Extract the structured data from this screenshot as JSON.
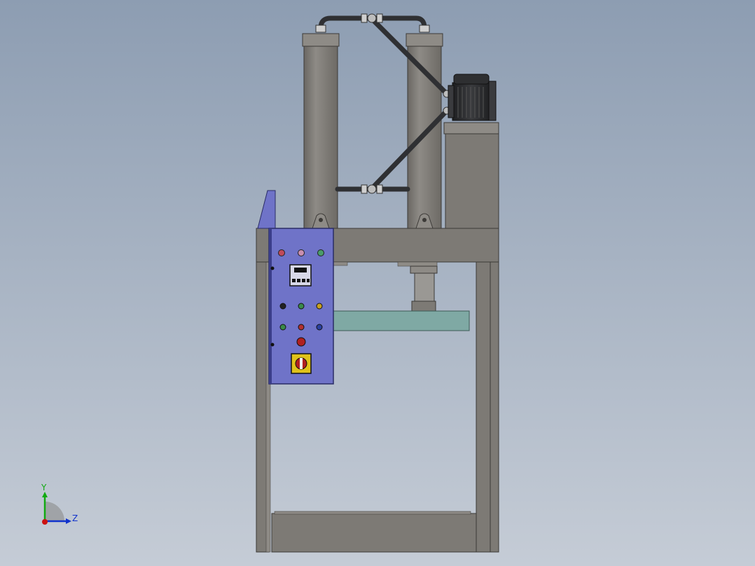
{
  "scene": {
    "background_top": "#8d9db2",
    "background_bottom": "#c5ccd6"
  },
  "materials": {
    "steel": "#7d7a75",
    "steel_light": "#8e8b86",
    "steel_dark": "#55524e",
    "panel_blue": "#6f73c8",
    "panel_blue_dark": "#3a3d8a",
    "platen_green": "#7fa9a4",
    "hose": "#2f3033",
    "motor": "#2a2b2d"
  },
  "control_panel": {
    "indicator_colors": [
      "#c04a5a",
      "#c98fb0",
      "#4a9c6a"
    ],
    "button_row1": [
      "#222222",
      "#3a8a4a",
      "#c8a020"
    ],
    "button_row2": [
      "#3a8a4a",
      "#b03030",
      "#2a40a0"
    ],
    "estop_color": "#b02020",
    "selector_color": "#e0c21a"
  },
  "triad": {
    "x_axis_color": "#cc1111",
    "y_axis_color": "#11aa11",
    "z_axis_color": "#1133cc",
    "y_label": "Y",
    "z_label": "Z"
  }
}
